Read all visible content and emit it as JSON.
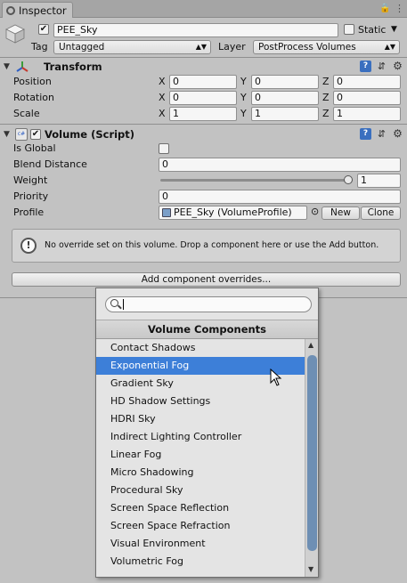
{
  "window": {
    "tab_label": "Inspector",
    "menu_icon": "⋮",
    "lock_icon": "🔒"
  },
  "gameobject": {
    "active": true,
    "name": "PEE_Sky",
    "static_label": "Static",
    "static_checked": false,
    "tag_label": "Tag",
    "tag_value": "Untagged",
    "layer_label": "Layer",
    "layer_value": "PostProcess Volumes"
  },
  "transform": {
    "title": "Transform",
    "rows": [
      {
        "label": "Position",
        "x": "0",
        "y": "0",
        "z": "0"
      },
      {
        "label": "Rotation",
        "x": "0",
        "y": "0",
        "z": "0"
      },
      {
        "label": "Scale",
        "x": "1",
        "y": "1",
        "z": "1"
      }
    ],
    "axis_x": "X",
    "axis_y": "Y",
    "axis_z": "Z"
  },
  "volume": {
    "title": "Volume (Script)",
    "enabled": true,
    "is_global_label": "Is Global",
    "is_global": false,
    "blend_distance_label": "Blend Distance",
    "blend_distance": "0",
    "weight_label": "Weight",
    "weight": "1",
    "weight_fraction": 1.0,
    "priority_label": "Priority",
    "priority": "0",
    "profile_label": "Profile",
    "profile_value": "PEE_Sky (VolumeProfile)",
    "new_button": "New",
    "clone_button": "Clone",
    "help_message": "No override set on this volume. Drop a component here or use the Add button.",
    "add_button": "Add component overrides..."
  },
  "popup": {
    "search_value": "",
    "title": "Volume Components",
    "items": [
      "Contact Shadows",
      "Exponential Fog",
      "Gradient Sky",
      "HD Shadow Settings",
      "HDRI Sky",
      "Indirect Lighting Controller",
      "Linear Fog",
      "Micro Shadowing",
      "Procedural Sky",
      "Screen Space Reflection",
      "Screen Space Refraction",
      "Visual Environment",
      "Volumetric Fog"
    ],
    "selected_index": 1
  },
  "colors": {
    "selection": "#3d7fd8",
    "panel": "#c2c2c2",
    "help_icon": "#3a6fbf"
  }
}
